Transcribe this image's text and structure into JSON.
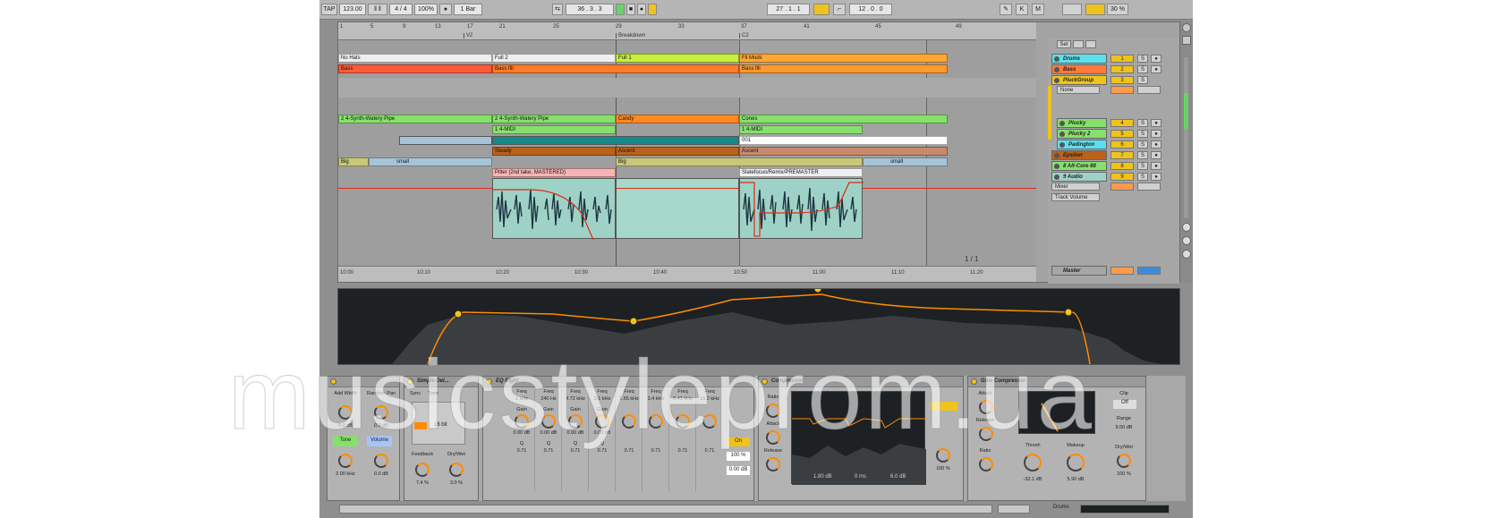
{
  "transport": {
    "tap": "TAP",
    "tempo": "123.00",
    "signature": "4 / 4",
    "zoom": "100%",
    "quant": "1 Bar",
    "position": "36 .  3 .  3",
    "loop_start": "27 .  1 .  1",
    "loop_len": "12 .  0 .  0",
    "cpu": "30 %"
  },
  "ruler": {
    "bars": [
      "1",
      "5",
      "9",
      "13",
      "17",
      "21",
      "25",
      "29",
      "33",
      "37",
      "41",
      "45",
      "49"
    ],
    "locators": [
      "V2",
      "Breakdown",
      "C2"
    ]
  },
  "timeline": [
    "10:00",
    "10:10",
    "10:20",
    "10:30",
    "10:40",
    "10:50",
    "11:00",
    "11:10",
    "11:20"
  ],
  "clips": [
    {
      "name": "No Hats",
      "color": "#efefef"
    },
    {
      "name": "Full 2",
      "color": "#efefef"
    },
    {
      "name": "Full 1",
      "color": "#c8f03c"
    },
    {
      "name": "Fil Mods",
      "color": "#ffa733"
    },
    {
      "name": "Bass",
      "color": "#ff5b3a"
    },
    {
      "name": "Bass fill",
      "color": "#ff7a2a"
    },
    {
      "name": "Bass fill",
      "color": "#ff9a2e"
    },
    {
      "name": "2 4-Synth-Watery Pipe",
      "color": "#86e06c"
    },
    {
      "name": "2 4-Synth-Watery Pipe",
      "color": "#86e06c"
    },
    {
      "name": "Candy",
      "color": "#ff8a24"
    },
    {
      "name": "Cones",
      "color": "#86e06c"
    },
    {
      "name": "1 4-MIDI",
      "color": "#86e06c"
    },
    {
      "name": "1 4-MIDI",
      "color": "#86e06c"
    },
    {
      "name": "001",
      "color": "#ffffff"
    },
    {
      "name": "Steady",
      "color": "#b8621c"
    },
    {
      "name": "Ascent",
      "color": "#b8621c"
    },
    {
      "name": "Ascent",
      "color": "#c88a6c"
    },
    {
      "name": "Big",
      "color": "#c8c878"
    },
    {
      "name": "small",
      "color": "#a6c4d8"
    },
    {
      "name": "Big",
      "color": "#c8c878"
    },
    {
      "name": "small",
      "color": "#a6c4d8"
    },
    {
      "name": "Pilter (2nd take, MASTERED)",
      "color": "#f8b4b4"
    },
    {
      "name": "Slatefocus/Remix/PREMASTER",
      "color": "#efefef"
    }
  ],
  "mixer": {
    "top_buttons": [
      "Set",
      "",
      ""
    ],
    "tracks": [
      {
        "name": "Drums",
        "color": "#5ce0f0",
        "num": "1"
      },
      {
        "name": "Bass",
        "color": "#ff7a3a",
        "num": "2"
      },
      {
        "name": "PluckGroup",
        "color": "#f0c31c",
        "num": "3"
      },
      {
        "name": "Plucky",
        "color": "#86e06c",
        "num": "4"
      },
      {
        "name": "Plucky 2",
        "color": "#86e06c",
        "num": "5"
      },
      {
        "name": "Padington",
        "color": "#5ce0f0",
        "num": "6"
      },
      {
        "name": "Epsilon",
        "color": "#b8621c",
        "num": "7"
      },
      {
        "name": "8 Alt-Core 88",
        "color": "#86e06c",
        "num": "8"
      },
      {
        "name": "9 Audio",
        "color": "#9ed2c6",
        "num": "9"
      },
      {
        "name": "Master",
        "color": "#a6a6a6",
        "num": ""
      }
    ],
    "none_select": "None",
    "mixer_select": "Mixer",
    "track_volume": "Track Volume",
    "page_counter": "1 / 1"
  },
  "devices": {
    "d0": {
      "labels": [
        "Add Width",
        "Random Pan",
        "Tone",
        "Volume"
      ],
      "values": [
        "0.0 dB",
        "0.0 dB",
        "2.00 kHz",
        "0.0 dB"
      ]
    },
    "simple_delay": {
      "title": "Simple Del...",
      "labels": [
        "Sync",
        "Time",
        "Feedback",
        "Dry/Wet"
      ],
      "values": [
        "16 bit",
        "7.4 %",
        "3.0 %"
      ]
    },
    "eq_eight": {
      "title": "EQ Eight",
      "labels": [
        "Freq",
        "Gain",
        "Q"
      ],
      "freqs": [
        "1 kHz",
        "240 Hz",
        "4.72 kHz",
        "3.1 kHz",
        "1.65 kHz",
        "3.4 kHz",
        "8.41 kHz",
        "15.2 kHz"
      ],
      "gains": [
        "0.00 dB",
        "0.00 dB",
        "0.00 dB",
        "0.00 dB"
      ],
      "qs": [
        "0.71",
        "0.71",
        "0.71",
        "0.71",
        "0.71",
        "0.71",
        "0.71",
        "0.71"
      ],
      "adapt": "On",
      "scale": "100 %",
      "gain": "0.00 dB"
    },
    "compressor": {
      "title": "Compressor",
      "labels": [
        "Ratio",
        "Attack",
        "Release",
        "Thresh",
        "Out",
        "Lookahead",
        "Knee"
      ],
      "values": [
        "4.00:1",
        "2.00 ms",
        "50.0 ms",
        "1.80 dB",
        "0 ms",
        "6.0 dB",
        "100 %"
      ]
    },
    "glue": {
      "title": "Glue Compressor",
      "labels": [
        "Attack",
        "Release",
        "Ratio",
        "Thresh",
        "Makeup",
        "Clip",
        "Range",
        "Dry/Wet"
      ],
      "values": [
        "0.3",
        "0.1",
        "4",
        "-32.1 dB",
        "5.90 dB",
        "Off",
        "9.00 dB",
        "100 %"
      ]
    }
  },
  "bottom": {
    "track_label": "Drums"
  },
  "watermark": "musicstyleprom.ua"
}
